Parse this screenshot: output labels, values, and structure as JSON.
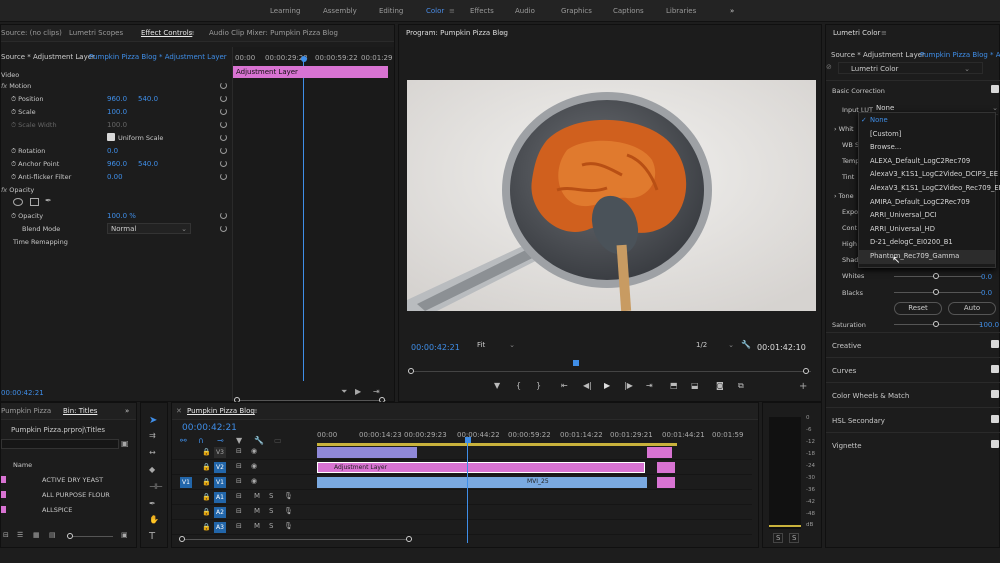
{
  "workspaces": [
    {
      "label": "Learning"
    },
    {
      "label": "Assembly"
    },
    {
      "label": "Editing"
    },
    {
      "label": "Color"
    },
    {
      "label": "Effects"
    },
    {
      "label": "Audio"
    },
    {
      "label": "Graphics"
    },
    {
      "label": "Captions"
    },
    {
      "label": "Libraries"
    }
  ],
  "more_label": "»",
  "source_panel": {
    "tabs": [
      {
        "label": "Source: (no clips)"
      },
      {
        "label": "Lumetri Scopes"
      },
      {
        "label": "Effect Controls"
      },
      {
        "label": "Audio Clip Mixer: Pumpkin Pizza Blog"
      }
    ],
    "master": "Source * Adjustment Layer",
    "clip": "Pumpkin Pizza Blog * Adjustment Layer",
    "video_label": "Video",
    "mini_times": [
      "00:00",
      "00:00:29:23",
      "00:00:59:22",
      "00:01:29"
    ],
    "mini_clip": "Adjustment Layer",
    "motion": "Motion",
    "position_label": "Position",
    "position_x": "960.0",
    "position_y": "540.0",
    "scale_label": "Scale",
    "scale_val": "100.0",
    "scale_width_label": "Scale Width",
    "scale_width_val": "100.0",
    "uniform": "Uniform Scale",
    "rotation_label": "Rotation",
    "rotation_val": "0.0",
    "anchor_label": "Anchor Point",
    "anchor_x": "960.0",
    "anchor_y": "540.0",
    "antiflicker_label": "Anti-flicker Filter",
    "antiflicker_val": "0.00",
    "opacity_section": "Opacity",
    "opacity_label": "Opacity",
    "opacity_val": "100.0 %",
    "blend_label": "Blend Mode",
    "blend_val": "Normal",
    "time_remap": "Time Remapping",
    "bottom_time": "00:00:42:21"
  },
  "program": {
    "title": "Program: Pumpkin Pizza Blog",
    "timecode": "00:00:42:21",
    "fit": "Fit",
    "resolution": "1/2",
    "duration": "00:01:42:10"
  },
  "lumetri": {
    "title": "Lumetri Color",
    "master": "Source * Adjustment Layer",
    "clip": "Pumpkin Pizza Blog * Adjustment Layer",
    "effect": "Lumetri Color",
    "basic_correction": "Basic Correction",
    "input_lut_label": "Input LUT",
    "input_lut_val": "None",
    "white_label": "Whit",
    "wb_label": "WB S",
    "temp_label": "Temp",
    "tint_label": "Tint",
    "tone_label": "Tone",
    "expo_label": "Expo",
    "cont_label": "Cont",
    "high_label": "High",
    "shad_label": "Shad",
    "whites_label": "Whites",
    "whites_val": "0.0",
    "blacks_label": "Blacks",
    "blacks_val": "0.0",
    "reset": "Reset",
    "auto": "Auto",
    "saturation_label": "Saturation",
    "saturation_val": "100.0",
    "sections": [
      {
        "label": "Creative"
      },
      {
        "label": "Curves"
      },
      {
        "label": "Color Wheels & Match"
      },
      {
        "label": "HSL Secondary"
      },
      {
        "label": "Vignette"
      }
    ],
    "lut_options": [
      {
        "label": "None",
        "checked": "✓"
      },
      {
        "label": "[Custom]"
      },
      {
        "label": "Browse..."
      },
      {
        "label": "ALEXA_Default_LogC2Rec709"
      },
      {
        "label": "AlexaV3_K1S1_LogC2Video_DCIP3_EE"
      },
      {
        "label": "AlexaV3_K1S1_LogC2Video_Rec709_EE"
      },
      {
        "label": "AMIRA_Default_LogC2Rec709"
      },
      {
        "label": "ARRI_Universal_DCI"
      },
      {
        "label": "ARRI_Universal_HD"
      },
      {
        "label": "D-21_delogC_EI0200_B1"
      },
      {
        "label": "Phantom_Rec709_Gamma"
      }
    ]
  },
  "project": {
    "tab1": "Pumpkin Pizza",
    "tab2": "Bin: Titles",
    "path": "Pumpkin Pizza.prproj\\Titles",
    "name_header": "Name",
    "items": [
      {
        "label": "ACTIVE DRY YEAST"
      },
      {
        "label": "ALL PURPOSE FLOUR"
      },
      {
        "label": "ALLSPICE"
      }
    ]
  },
  "timeline": {
    "title": "Pumpkin Pizza Blog",
    "timecode": "00:00:42:21",
    "ruler": [
      "00:00",
      "00:00:14:23",
      "00:00:29:23",
      "00:00:44:22",
      "00:00:59:22",
      "00:01:14:22",
      "00:01:29:21",
      "00:01:44:21",
      "00:01:59"
    ],
    "tracks": [
      {
        "label": "V3"
      },
      {
        "label": "V2"
      },
      {
        "label": "V1"
      },
      {
        "label": "A1"
      },
      {
        "label": "A2"
      },
      {
        "label": "A3"
      }
    ],
    "src_v1": "V1",
    "adj_clip": "Adjustment Layer",
    "mvi": "MVI_25",
    "m": "M",
    "s": "S"
  },
  "meter": {
    "ticks": [
      "0",
      "-6",
      "-12",
      "-18",
      "-24",
      "-30",
      "-36",
      "-42",
      "-48",
      "dB"
    ],
    "s1": "S",
    "s2": "S"
  },
  "colors": {
    "accent": "#3f8ee8",
    "adjustment": "#d873d2",
    "video_clip": "#7aa9e0",
    "track_button": "#2266aa"
  }
}
